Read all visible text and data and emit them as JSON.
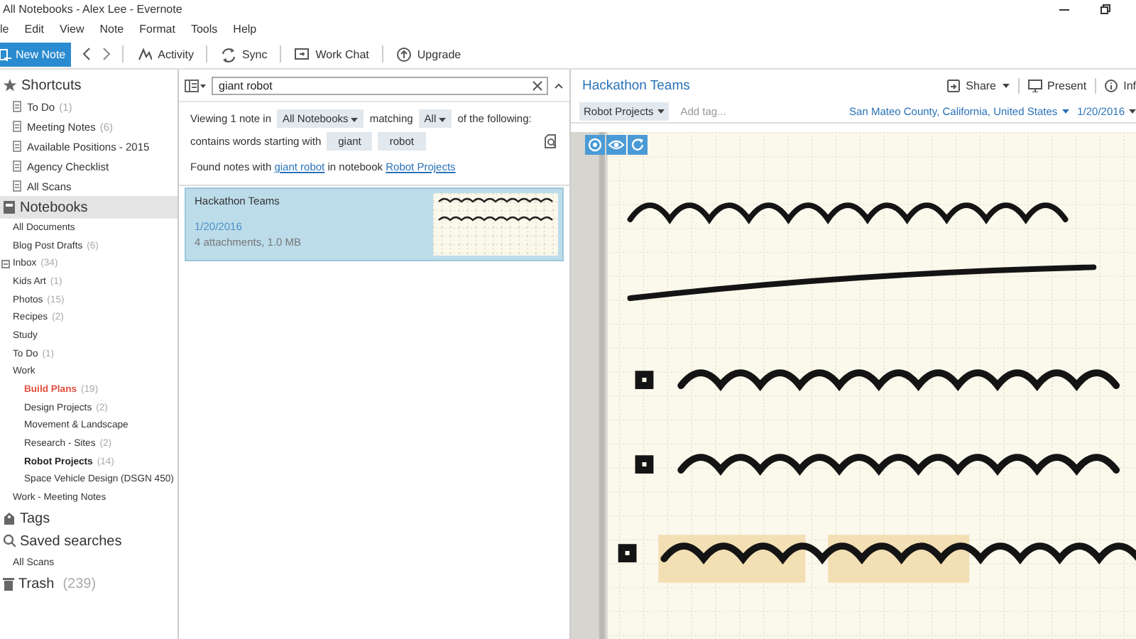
{
  "window": {
    "title": "All Notebooks - Alex Lee - Evernote"
  },
  "menu": [
    "le",
    "Edit",
    "View",
    "Note",
    "Format",
    "Tools",
    "Help"
  ],
  "toolbar": {
    "new_note": "New Note",
    "buttons": [
      {
        "kind": "activity",
        "label": "Activity"
      },
      {
        "kind": "sync",
        "label": "Sync"
      },
      {
        "kind": "chat",
        "label": "Work Chat"
      },
      {
        "kind": "upgrade",
        "label": "Upgrade"
      }
    ]
  },
  "sidebar": {
    "shortcuts": {
      "title": "Shortcuts",
      "items": [
        {
          "label": "To Do",
          "count": "(1)"
        },
        {
          "label": "Meeting Notes",
          "count": "(6)"
        },
        {
          "label": "Available Positions - 2015"
        },
        {
          "label": "Agency Checklist"
        },
        {
          "label": "All Scans"
        }
      ]
    },
    "notebooks": {
      "title": "Notebooks",
      "selected": true,
      "items": [
        {
          "label": "All Documents",
          "kind": "plain"
        },
        {
          "label": "Blog Post Drafts",
          "count": "(6)",
          "kind": "plain"
        },
        {
          "label": "Inbox",
          "count": "(34)",
          "kind": "plain",
          "expanded": true
        },
        {
          "label": "Kids Art",
          "count": "(1)",
          "kind": "plain"
        },
        {
          "label": "Photos",
          "count": "(15)",
          "kind": "plain"
        },
        {
          "label": "Recipes",
          "count": "(2)",
          "kind": "plain"
        },
        {
          "label": "Study",
          "kind": "plain"
        },
        {
          "label": "To Do",
          "count": "(1)",
          "kind": "plain"
        },
        {
          "label": "Work",
          "kind": "plain",
          "children": [
            {
              "label": "Build Plans",
              "count": "(19)",
              "kind": "highlighted"
            },
            {
              "label": "Design Projects",
              "count": "(2)",
              "kind": "plain"
            },
            {
              "label": "Movement & Landscape",
              "kind": "plain"
            },
            {
              "label": "Research - Sites",
              "count": "(2)",
              "kind": "plain"
            },
            {
              "label": "Robot Projects",
              "count": "(14)",
              "kind": "bold"
            },
            {
              "label": "Space Vehicle Design (DSGN 450)",
              "kind": "plain"
            }
          ]
        },
        {
          "label": "Work - Meeting Notes",
          "kind": "plain"
        }
      ]
    },
    "tags": {
      "title": "Tags"
    },
    "saved_searches": {
      "title": "Saved searches",
      "items": [
        "All Scans"
      ]
    },
    "trash": {
      "title": "Trash",
      "count": "(239)"
    }
  },
  "search": {
    "value": "giant robot"
  },
  "filter": {
    "viewing": "Viewing 1 note in",
    "notebook": "All Notebooks",
    "matching": "matching",
    "mode": "All",
    "following": "of the following:",
    "contains": "contains words starting with",
    "terms": [
      "giant",
      "robot"
    ]
  },
  "found": {
    "prefix": "Found notes with",
    "query": "giant robot",
    "middle": "in notebook",
    "notebook": "Robot Projects"
  },
  "notes": [
    {
      "title": "Hackathon Teams",
      "date": "1/20/2016",
      "meta": "4 attachments,  1.0 MB",
      "selected": true
    }
  ],
  "note": {
    "title": "Hackathon Teams",
    "share": "Share",
    "present": "Present",
    "info": "Inf",
    "notebook": "Robot Projects",
    "tag_placeholder": "Add tag...",
    "location": "San Mateo County, California, United States",
    "date": "1/20/2016"
  }
}
